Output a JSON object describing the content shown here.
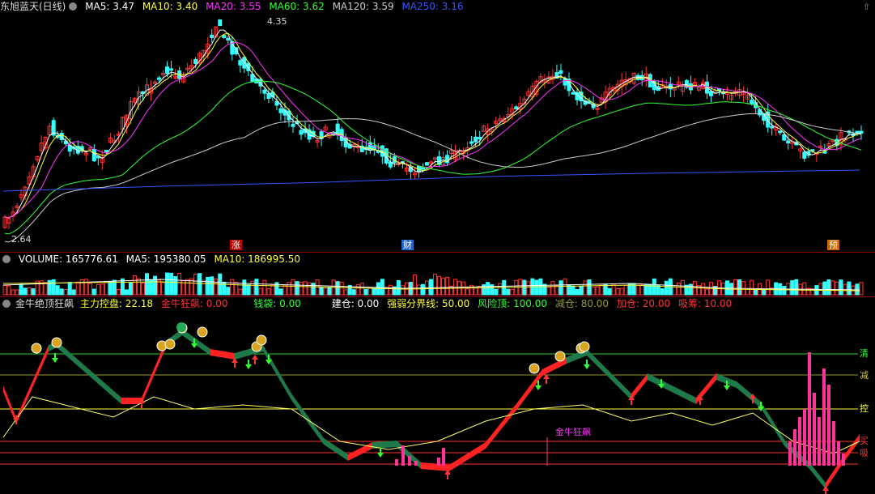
{
  "main_legend": {
    "title": "东旭蓝天(日线)",
    "items": [
      {
        "label": "MA5: 3.47",
        "color": "#ffffff"
      },
      {
        "label": "MA10: 3.40",
        "color": "#ffff33"
      },
      {
        "label": "MA20: 3.55",
        "color": "#ff33ff"
      },
      {
        "label": "MA60: 3.62",
        "color": "#33ff33"
      },
      {
        "label": "MA120: 3.59",
        "color": "#cccccc"
      },
      {
        "label": "MA250: 3.16",
        "color": "#3355ff"
      }
    ],
    "high_label": "4.35",
    "low_label": "2.64",
    "markers": [
      "涨",
      "财",
      "预"
    ]
  },
  "volume_legend": {
    "items": [
      {
        "label": "VOLUME: 165776.61",
        "color": "#ffffff"
      },
      {
        "label": "MA5: 195380.05",
        "color": "#ffffff"
      },
      {
        "label": "MA10: 186995.50",
        "color": "#ffff33"
      }
    ]
  },
  "indicator_legend": {
    "title": "金牛绝顶狂飙",
    "items": [
      {
        "label": "主力控盘: 22.18",
        "color": "#ffff33"
      },
      {
        "label": "金牛狂飙: 0.00",
        "color": "#ff3333"
      },
      {
        "label": "钱袋: 0.00",
        "color": "#33ff33"
      },
      {
        "label": "建仓: 0.00",
        "color": "#ffffff"
      },
      {
        "label": "强弱分界线: 50.00",
        "color": "#ffff33"
      },
      {
        "label": "风险顶: 100.00",
        "color": "#33ff33"
      },
      {
        "label": "减仓: 80.00",
        "color": "#999933"
      },
      {
        "label": "加仓: 20.00",
        "color": "#ff3333"
      },
      {
        "label": "吸筹: 10.00",
        "color": "#ff3333"
      }
    ],
    "level_labels": [
      "清",
      "减",
      "控",
      "买",
      "吸"
    ],
    "annotation": "金牛狂飙"
  },
  "colors": {
    "up": "#ff3333",
    "down": "#33ffff",
    "bg": "#000000"
  }
}
